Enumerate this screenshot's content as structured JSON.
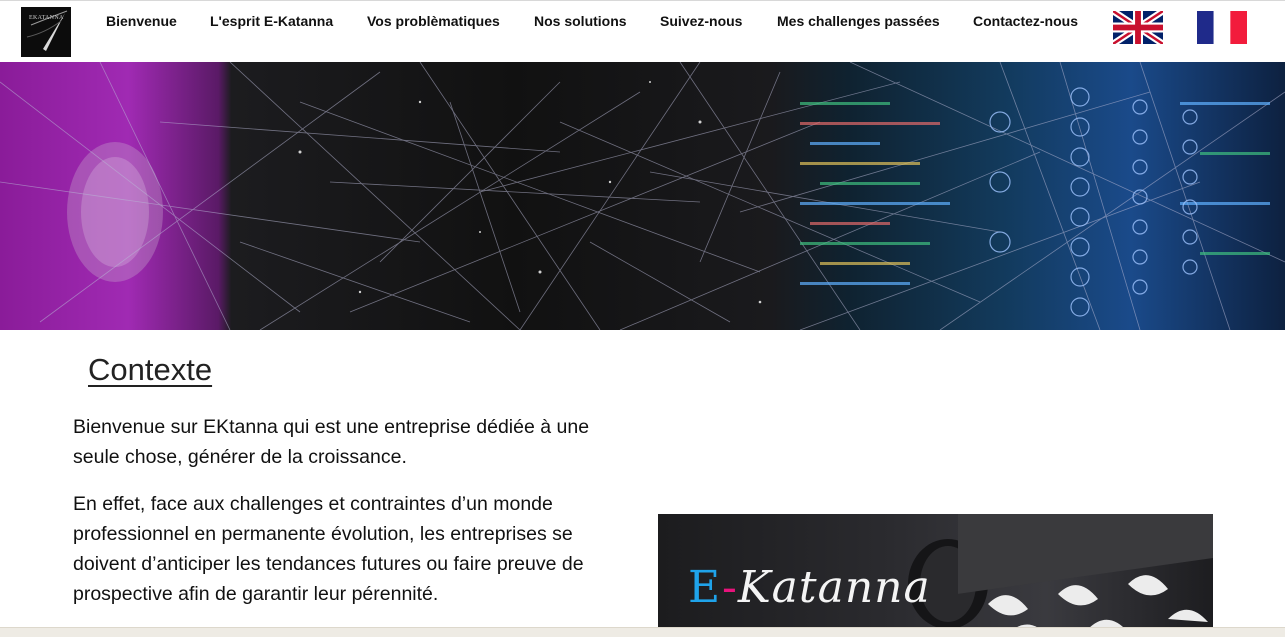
{
  "nav": {
    "logo_text": "EKATANNA",
    "items": [
      {
        "label": "Bienvenue"
      },
      {
        "label": "L'esprit E-Katanna"
      },
      {
        "label": "Vos problèmatiques"
      },
      {
        "label": "Nos solutions"
      },
      {
        "label": "Suivez-nous"
      },
      {
        "label": "Mes challenges passées"
      },
      {
        "label": "Contactez-nous"
      }
    ],
    "languages": [
      {
        "icon": "uk-flag-icon",
        "code": "en"
      },
      {
        "icon": "france-flag-icon",
        "code": "fr"
      }
    ]
  },
  "main": {
    "section_title": "Contexte",
    "paragraphs": [
      "Bienvenue sur EKtanna qui est une entreprise dédiée à une seule chose, générer de la croissance.",
      "En effet, face aux challenges et contraintes d’un monde professionnel en permanente évolution, les entreprises se doivent d’anticiper les tendances futures ou faire preuve de prospective afin de garantir leur pérennité."
    ],
    "promo": {
      "prefix_e": "E",
      "dash": "-",
      "rest": "Katanna"
    }
  },
  "colors": {
    "accent_blue": "#1fa3ea",
    "accent_pink": "#e8137c",
    "banner_purple": "#a02ab3"
  }
}
